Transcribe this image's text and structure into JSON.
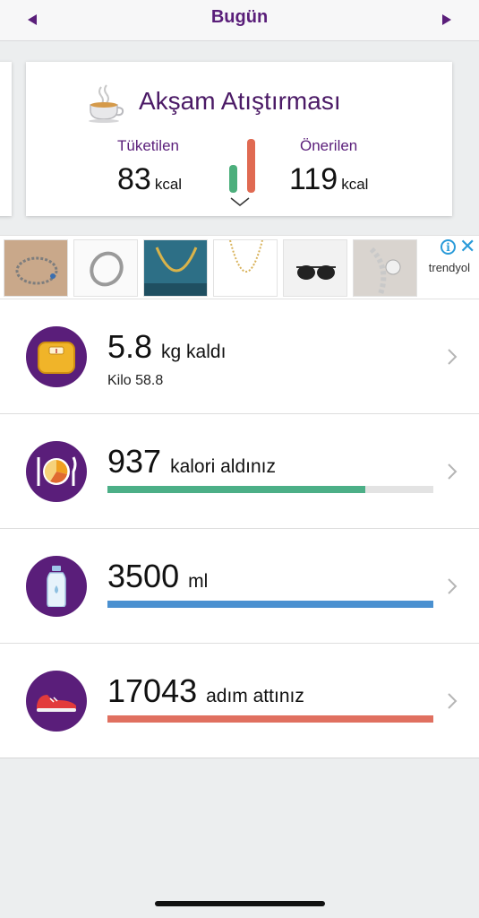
{
  "header": {
    "title": "Bugün"
  },
  "meal": {
    "title": "Akşam Atıştırması",
    "consumed_label": "Tüketilen",
    "consumed_value": "83",
    "recommended_label": "Önerilen",
    "recommended_value": "119",
    "unit": "kcal"
  },
  "ad": {
    "brand": "trendyol",
    "info_glyph": "i",
    "close_glyph": "✕",
    "item_count": 6
  },
  "stats": {
    "weight": {
      "value": "5.8",
      "suffix": "kg kaldı",
      "sub": "Kilo 58.8",
      "icon": "scale-icon"
    },
    "calories": {
      "value": "937",
      "suffix": "kalori aldınız",
      "progress": 0.79,
      "color": "#4caf87",
      "icon": "plate-icon"
    },
    "water": {
      "value": "3500",
      "suffix": "ml",
      "progress": 1.0,
      "color": "#4a90d0",
      "icon": "water-bottle-icon"
    },
    "steps": {
      "value": "17043",
      "suffix": "adım attınız",
      "progress": 1.0,
      "color": "#e07060",
      "icon": "shoe-icon"
    }
  },
  "colors": {
    "brand": "#5a1e7a",
    "green": "#4caf7c",
    "red": "#e06a52"
  }
}
